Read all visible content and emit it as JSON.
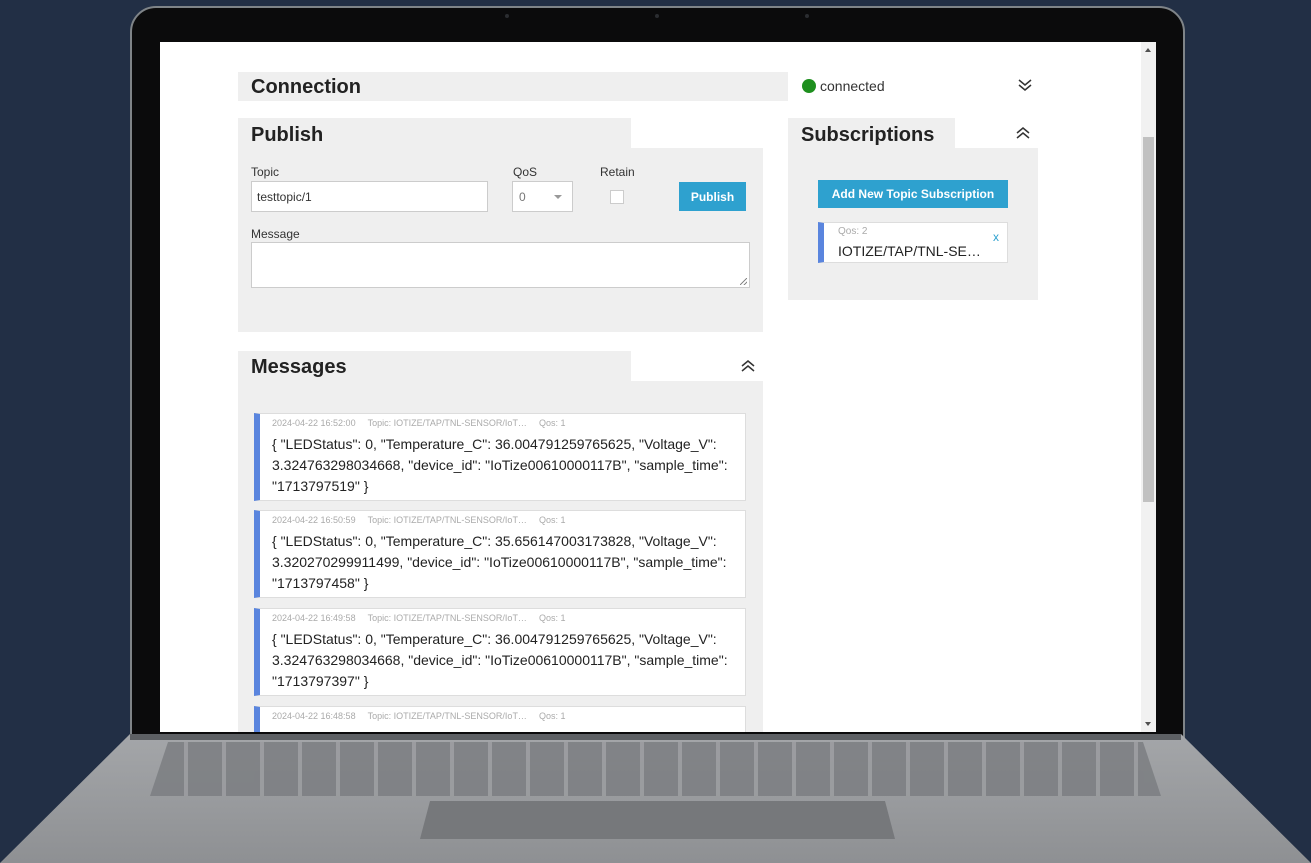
{
  "connection": {
    "title": "Connection",
    "status": "connected",
    "status_color": "#1e8f1e",
    "toggle_icon": "chevron-double-down-icon"
  },
  "publish": {
    "title": "Publish",
    "toggle_icon": "chevron-double-up-icon",
    "topic_label": "Topic",
    "topic_value": "testtopic/1",
    "qos_label": "QoS",
    "qos_value": "0",
    "retain_label": "Retain",
    "retain_checked": false,
    "message_label": "Message",
    "message_value": "",
    "publish_button": "Publish"
  },
  "subscriptions": {
    "title": "Subscriptions",
    "toggle_icon": "chevron-double-up-icon",
    "add_button": "Add New Topic Subscription",
    "items": [
      {
        "qos": "Qos: 2",
        "topic": "IOTIZE/TAP/TNL-SE…",
        "close": "x"
      }
    ]
  },
  "messages": {
    "title": "Messages",
    "toggle_icon": "chevron-double-up-icon",
    "items": [
      {
        "time": "2024-04-22 16:52:00",
        "topic": "Topic: IOTIZE/TAP/TNL-SENSOR/IoT…",
        "qos": "Qos: 1",
        "payload": "{ \"LEDStatus\": 0, \"Temperature_C\": 36.004791259765625, \"Voltage_V\": 3.324763298034668, \"device_id\": \"IoTize00610000117B\", \"sample_time\": \"1713797519\" }"
      },
      {
        "time": "2024-04-22 16:50:59",
        "topic": "Topic: IOTIZE/TAP/TNL-SENSOR/IoT…",
        "qos": "Qos: 1",
        "payload": "{ \"LEDStatus\": 0, \"Temperature_C\": 35.656147003173828, \"Voltage_V\": 3.320270299911499, \"device_id\": \"IoTize00610000117B\", \"sample_time\": \"1713797458\" }"
      },
      {
        "time": "2024-04-22 16:49:58",
        "topic": "Topic: IOTIZE/TAP/TNL-SENSOR/IoT…",
        "qos": "Qos: 1",
        "payload": "{ \"LEDStatus\": 0, \"Temperature_C\": 36.004791259765625, \"Voltage_V\": 3.324763298034668, \"device_id\": \"IoTize00610000117B\", \"sample_time\": \"1713797397\" }"
      },
      {
        "time": "2024-04-22 16:48:58",
        "topic": "Topic: IOTIZE/TAP/TNL-SENSOR/IoT…",
        "qos": "Qos: 1",
        "payload": ""
      }
    ]
  },
  "colors": {
    "accent": "#2ea1cf",
    "card_border": "#5a85de",
    "panel_bg": "#efefef"
  }
}
